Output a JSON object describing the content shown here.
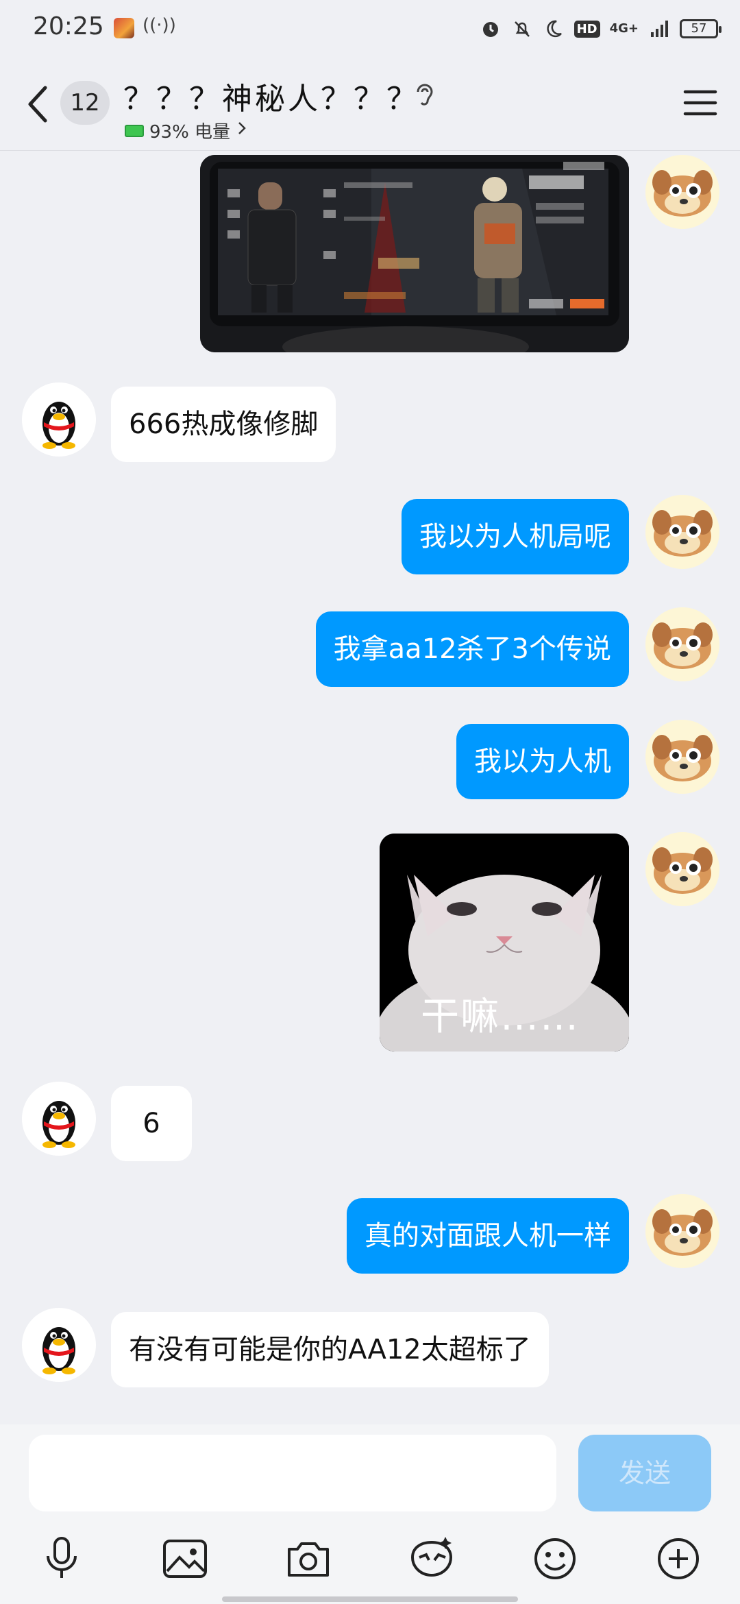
{
  "status_bar": {
    "time": "20:25",
    "network": "4G+",
    "battery_level": "57",
    "icons": [
      "alarm-icon",
      "mute-icon",
      "moon-icon",
      "hd-icon",
      "signal-icon",
      "battery-icon"
    ]
  },
  "header": {
    "unread_count": "12",
    "title": "？？？神秘人？？？",
    "battery_status": "93% 电量",
    "icons": [
      "back-icon",
      "ear-icon",
      "menu-icon"
    ]
  },
  "messages": [
    {
      "from": "me",
      "type": "image",
      "desc": "photo-game-screen"
    },
    {
      "from": "other",
      "type": "text",
      "text": "666热成像修脚"
    },
    {
      "from": "me",
      "type": "text",
      "text": "我以为人机局呢"
    },
    {
      "from": "me",
      "type": "text",
      "text": "我拿aa12杀了3个传说"
    },
    {
      "from": "me",
      "type": "text",
      "text": "我以为人机"
    },
    {
      "from": "me",
      "type": "sticker",
      "caption": "干嘛……"
    },
    {
      "from": "other",
      "type": "text",
      "text": "6"
    },
    {
      "from": "me",
      "type": "text",
      "text": "真的对面跟人机一样"
    },
    {
      "from": "other",
      "type": "text",
      "text": "有没有可能是你的AA12太超标了"
    }
  ],
  "composer": {
    "send_label": "发送",
    "tools": [
      "mic-icon",
      "image-icon",
      "camera-icon",
      "ai-sticker-icon",
      "emoji-icon",
      "plus-icon"
    ]
  },
  "colors": {
    "outgoing_bubble": "#0099ff",
    "incoming_bubble": "#ffffff",
    "background": "#eff0f4"
  }
}
